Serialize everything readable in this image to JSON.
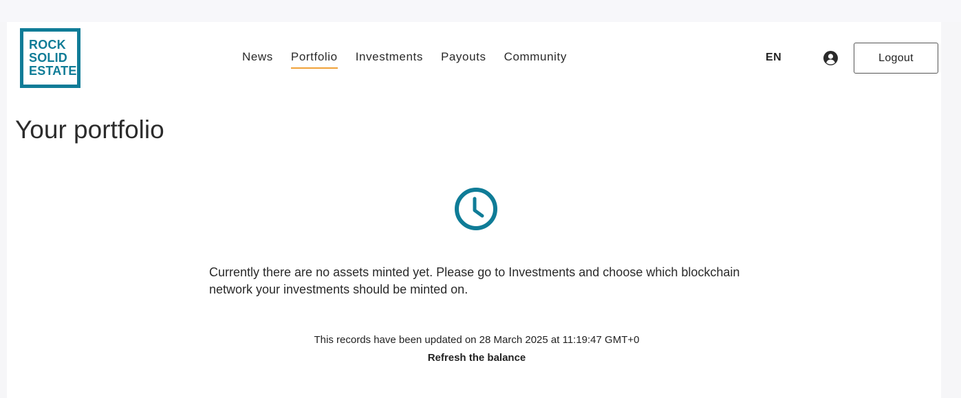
{
  "logo": {
    "lines": [
      "ROCK",
      "SOLID",
      "ESTATE"
    ],
    "color": "#0f7c97"
  },
  "nav": {
    "items": [
      {
        "label": "News",
        "active": false
      },
      {
        "label": "Portfolio",
        "active": true
      },
      {
        "label": "Investments",
        "active": false
      },
      {
        "label": "Payouts",
        "active": false
      },
      {
        "label": "Community",
        "active": false
      }
    ],
    "active_underline_color": "#f0a137"
  },
  "header": {
    "language": "EN",
    "user_icon": "user-circle-icon",
    "logout_label": "Logout"
  },
  "main": {
    "title": "Your portfolio",
    "status_icon": "clock-icon",
    "message": "Currently there are no assets minted yet. Please go to Investments and choose which blockchain network your investments should be minted on.",
    "updated_text": "This records have been updated on 28 March 2025 at 11:19:47 GMT+0",
    "refresh_label": "Refresh the balance"
  },
  "colors": {
    "brand": "#0f7c97",
    "accent": "#f0a137",
    "text": "#222222"
  }
}
